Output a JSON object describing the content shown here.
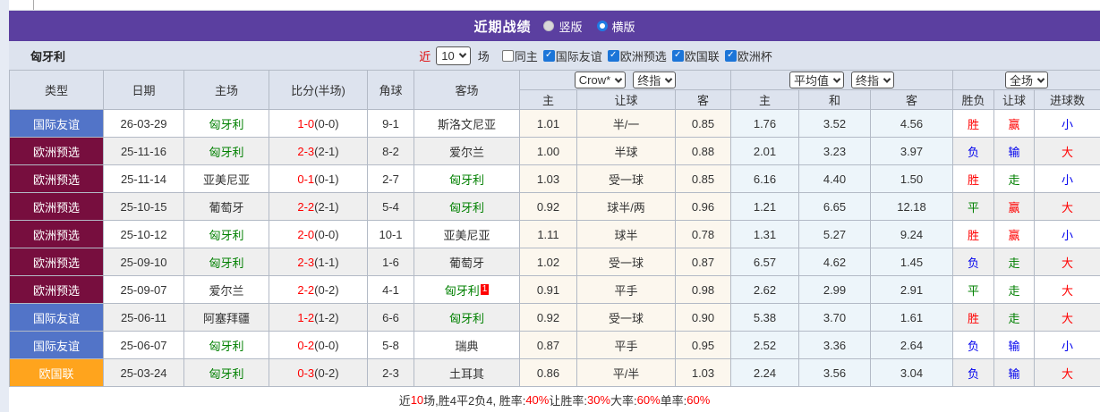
{
  "title_bar": {
    "title": "近期战绩",
    "view_options": [
      {
        "label": "竖版",
        "selected": false
      },
      {
        "label": "横版",
        "selected": true
      }
    ]
  },
  "filter_bar": {
    "team": "匈牙利",
    "recent_label": "近",
    "recent_count": "10",
    "matches_label": "场",
    "checkboxes": [
      {
        "label": "同主",
        "checked": false
      },
      {
        "label": "国际友谊",
        "checked": true
      },
      {
        "label": "欧洲预选",
        "checked": true
      },
      {
        "label": "欧国联",
        "checked": true
      },
      {
        "label": "欧洲杯",
        "checked": true
      }
    ]
  },
  "table": {
    "static_headers": [
      "类型",
      "日期",
      "主场",
      "比分(半场)",
      "角球",
      "客场"
    ],
    "odds_group": {
      "selects": [
        "Crow*",
        "终指"
      ],
      "sub_headers": [
        "主",
        "让球",
        "客"
      ]
    },
    "avg_group": {
      "selects": [
        "平均值",
        "终指"
      ],
      "sub_headers": [
        "主",
        "和",
        "客"
      ]
    },
    "result_group": {
      "selects": [
        "全场"
      ],
      "sub_headers": [
        "胜负",
        "让球",
        "进球数"
      ]
    },
    "rows": [
      {
        "type": "国际友谊",
        "date": "26-03-29",
        "home": {
          "name": "匈牙利",
          "is_team": true
        },
        "score_ft": "1-0",
        "score_ht": "(0-0)",
        "corner": "9-1",
        "away": {
          "name": "斯洛文尼亚",
          "is_team": false,
          "badge": ""
        },
        "crow_odds": [
          "1.01",
          "半/一",
          "0.85"
        ],
        "avg_odds": [
          "1.76",
          "3.52",
          "4.56"
        ],
        "full_results": [
          {
            "text": "胜",
            "c": "red"
          },
          {
            "text": "赢",
            "c": "red"
          },
          {
            "text": "小",
            "c": "blue"
          }
        ]
      },
      {
        "type": "欧洲预选",
        "date": "25-11-16",
        "home": {
          "name": "匈牙利",
          "is_team": true
        },
        "score_ft": "2-3",
        "score_ht": "(2-1)",
        "corner": "8-2",
        "away": {
          "name": "爱尔兰",
          "is_team": false,
          "badge": ""
        },
        "crow_odds": [
          "1.00",
          "半球",
          "0.88"
        ],
        "avg_odds": [
          "2.01",
          "3.23",
          "3.97"
        ],
        "full_results": [
          {
            "text": "负",
            "c": "blue"
          },
          {
            "text": "输",
            "c": "blue"
          },
          {
            "text": "大",
            "c": "red"
          }
        ]
      },
      {
        "type": "欧洲预选",
        "date": "25-11-14",
        "home": {
          "name": "亚美尼亚",
          "is_team": false
        },
        "score_ft": "0-1",
        "score_ht": "(0-1)",
        "corner": "2-7",
        "away": {
          "name": "匈牙利",
          "is_team": true,
          "badge": ""
        },
        "crow_odds": [
          "1.03",
          "受一球",
          "0.85"
        ],
        "avg_odds": [
          "6.16",
          "4.40",
          "1.50"
        ],
        "full_results": [
          {
            "text": "胜",
            "c": "red"
          },
          {
            "text": "走",
            "c": "green"
          },
          {
            "text": "小",
            "c": "blue"
          }
        ]
      },
      {
        "type": "欧洲预选",
        "date": "25-10-15",
        "home": {
          "name": "葡萄牙",
          "is_team": false
        },
        "score_ft": "2-2",
        "score_ht": "(2-1)",
        "corner": "5-4",
        "away": {
          "name": "匈牙利",
          "is_team": true,
          "badge": ""
        },
        "crow_odds": [
          "0.92",
          "球半/两",
          "0.96"
        ],
        "avg_odds": [
          "1.21",
          "6.65",
          "12.18"
        ],
        "full_results": [
          {
            "text": "平",
            "c": "green"
          },
          {
            "text": "赢",
            "c": "red"
          },
          {
            "text": "大",
            "c": "red"
          }
        ]
      },
      {
        "type": "欧洲预选",
        "date": "25-10-12",
        "home": {
          "name": "匈牙利",
          "is_team": true
        },
        "score_ft": "2-0",
        "score_ht": "(0-0)",
        "corner": "10-1",
        "away": {
          "name": "亚美尼亚",
          "is_team": false,
          "badge": ""
        },
        "crow_odds": [
          "1.11",
          "球半",
          "0.78"
        ],
        "avg_odds": [
          "1.31",
          "5.27",
          "9.24"
        ],
        "full_results": [
          {
            "text": "胜",
            "c": "red"
          },
          {
            "text": "赢",
            "c": "red"
          },
          {
            "text": "小",
            "c": "blue"
          }
        ]
      },
      {
        "type": "欧洲预选",
        "date": "25-09-10",
        "home": {
          "name": "匈牙利",
          "is_team": true
        },
        "score_ft": "2-3",
        "score_ht": "(1-1)",
        "corner": "1-6",
        "away": {
          "name": "葡萄牙",
          "is_team": false,
          "badge": ""
        },
        "crow_odds": [
          "1.02",
          "受一球",
          "0.87"
        ],
        "avg_odds": [
          "6.57",
          "4.62",
          "1.45"
        ],
        "full_results": [
          {
            "text": "负",
            "c": "blue"
          },
          {
            "text": "走",
            "c": "green"
          },
          {
            "text": "大",
            "c": "red"
          }
        ]
      },
      {
        "type": "欧洲预选",
        "date": "25-09-07",
        "home": {
          "name": "爱尔兰",
          "is_team": false
        },
        "score_ft": "2-2",
        "score_ht": "(0-2)",
        "corner": "4-1",
        "away": {
          "name": "匈牙利",
          "is_team": true,
          "badge": "1"
        },
        "crow_odds": [
          "0.91",
          "平手",
          "0.98"
        ],
        "avg_odds": [
          "2.62",
          "2.99",
          "2.91"
        ],
        "full_results": [
          {
            "text": "平",
            "c": "green"
          },
          {
            "text": "走",
            "c": "green"
          },
          {
            "text": "大",
            "c": "red"
          }
        ]
      },
      {
        "type": "国际友谊",
        "date": "25-06-11",
        "home": {
          "name": "阿塞拜疆",
          "is_team": false
        },
        "score_ft": "1-2",
        "score_ht": "(1-2)",
        "corner": "6-6",
        "away": {
          "name": "匈牙利",
          "is_team": true,
          "badge": ""
        },
        "crow_odds": [
          "0.92",
          "受一球",
          "0.90"
        ],
        "avg_odds": [
          "5.38",
          "3.70",
          "1.61"
        ],
        "full_results": [
          {
            "text": "胜",
            "c": "red"
          },
          {
            "text": "走",
            "c": "green"
          },
          {
            "text": "大",
            "c": "red"
          }
        ]
      },
      {
        "type": "国际友谊",
        "date": "25-06-07",
        "home": {
          "name": "匈牙利",
          "is_team": true
        },
        "score_ft": "0-2",
        "score_ht": "(0-0)",
        "corner": "5-8",
        "away": {
          "name": "瑞典",
          "is_team": false,
          "badge": ""
        },
        "crow_odds": [
          "0.87",
          "平手",
          "0.95"
        ],
        "avg_odds": [
          "2.52",
          "3.36",
          "2.64"
        ],
        "full_results": [
          {
            "text": "负",
            "c": "blue"
          },
          {
            "text": "输",
            "c": "blue"
          },
          {
            "text": "小",
            "c": "blue"
          }
        ]
      },
      {
        "type": "欧国联",
        "date": "25-03-24",
        "home": {
          "name": "匈牙利",
          "is_team": true
        },
        "score_ft": "0-3",
        "score_ht": "(0-2)",
        "corner": "2-3",
        "away": {
          "name": "土耳其",
          "is_team": false,
          "badge": ""
        },
        "crow_odds": [
          "0.86",
          "平/半",
          "1.03"
        ],
        "avg_odds": [
          "2.24",
          "3.56",
          "3.04"
        ],
        "full_results": [
          {
            "text": "负",
            "c": "blue"
          },
          {
            "text": "输",
            "c": "blue"
          },
          {
            "text": "大",
            "c": "red"
          }
        ]
      }
    ]
  },
  "footer": {
    "segments": [
      {
        "text": "近",
        "red": false
      },
      {
        "text": "10",
        "red": true
      },
      {
        "text": "场,胜4平2负4, 胜率:",
        "red": false
      },
      {
        "text": "40%",
        "red": true
      },
      {
        "text": " 让胜率:",
        "red": false
      },
      {
        "text": "30%",
        "red": true
      },
      {
        "text": " 大率:",
        "red": false
      },
      {
        "text": "60%",
        "red": true
      },
      {
        "text": " 单率:",
        "red": false
      },
      {
        "text": "60%",
        "red": true
      }
    ]
  },
  "colors": {
    "accent_purple": "#5b3fa0",
    "type_colors": {
      "国际友谊": "#5274c8",
      "欧洲预选": "#770e3e",
      "欧国联": "#ffa41d"
    },
    "result_map": {
      "red": "#ff0000",
      "green": "#008000",
      "blue": "#0000ee"
    },
    "team_green": "#008000",
    "score_red": "#ff0000",
    "badge_red": "#ff0000"
  }
}
